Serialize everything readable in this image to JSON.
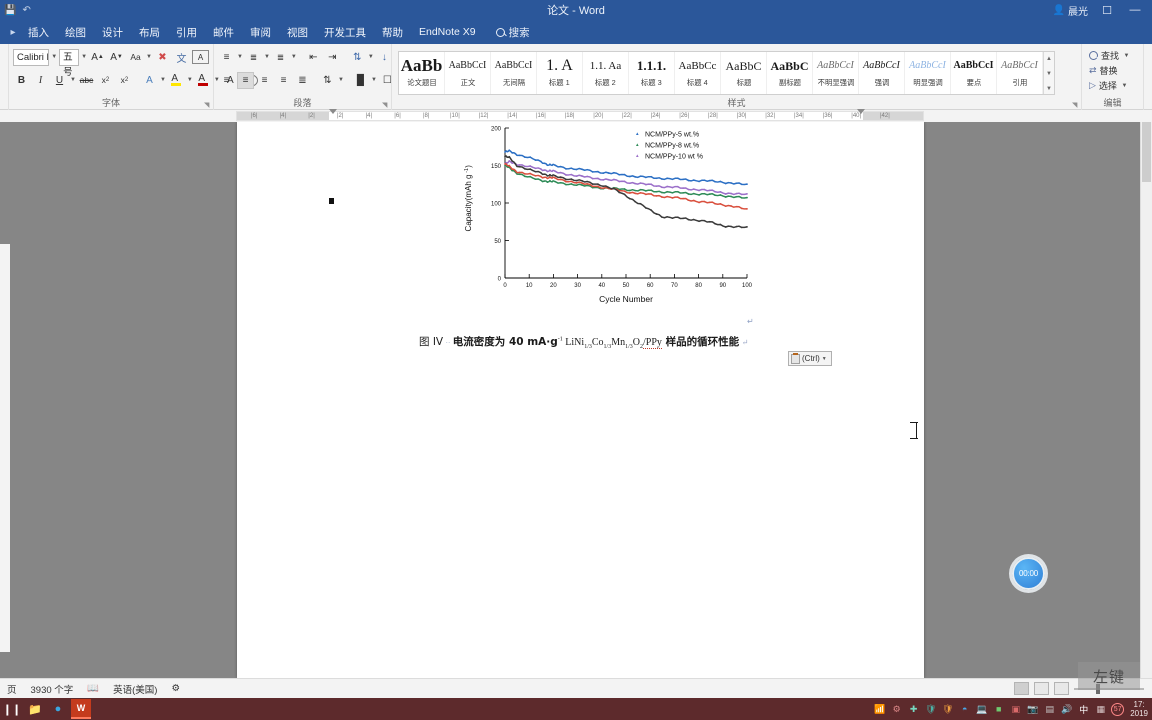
{
  "window": {
    "title": "论文 - Word",
    "user": "晨光",
    "quick_access": [
      "save-icon",
      "undo-icon"
    ],
    "ribbon_display_icon": "ribbon-display-options",
    "minimize": "—"
  },
  "tabs": [
    {
      "label": "插入"
    },
    {
      "label": "绘图"
    },
    {
      "label": "设计"
    },
    {
      "label": "布局"
    },
    {
      "label": "引用"
    },
    {
      "label": "邮件"
    },
    {
      "label": "审阅"
    },
    {
      "label": "视图"
    },
    {
      "label": "开发工具"
    },
    {
      "label": "帮助"
    },
    {
      "label": "EndNote X9"
    }
  ],
  "search": {
    "label": "搜索"
  },
  "font_group": {
    "label": "字体",
    "font_name": "Calibri Light",
    "font_size": "五号",
    "grow": "A",
    "shrink": "A",
    "change_case": "Aa",
    "clear_format": "clear-formatting-icon",
    "phonetic": "phonetic-guide-icon",
    "border": "character-border-icon",
    "bold": "B",
    "italic": "I",
    "underline": "U",
    "strike": "abc",
    "subscript": "x",
    "superscript": "x",
    "text_effects": "A",
    "highlight": "A",
    "font_color": "A",
    "char_shading": "A",
    "enclose": "字"
  },
  "paragraph_group": {
    "label": "段落",
    "buttons": [
      "bullets",
      "numbering",
      "multilevel",
      "decrease-indent",
      "increase-indent",
      "sort",
      "show-marks",
      "align-left",
      "align-center",
      "align-right",
      "justify",
      "distribute",
      "line-spacing",
      "shading",
      "borders"
    ]
  },
  "styles_group": {
    "label": "样式",
    "items": [
      {
        "preview": "AaBb",
        "name": "论文题目"
      },
      {
        "preview": "AaBbCcI",
        "name": "正文"
      },
      {
        "preview": "AaBbCcI",
        "name": "无间隔"
      },
      {
        "preview": "1. A",
        "name": "标题 1"
      },
      {
        "preview": "1.1. Aa",
        "name": "标题 2"
      },
      {
        "preview": "1.1.1.",
        "name": "标题 3"
      },
      {
        "preview": "AaBbCc",
        "name": "标题 4"
      },
      {
        "preview": "AaBbC",
        "name": "标题"
      },
      {
        "preview": "AaBbC",
        "name": "副标题"
      },
      {
        "preview": "AaBbCcI",
        "name": "不明显强调"
      },
      {
        "preview": "AaBbCcI",
        "name": "强调"
      },
      {
        "preview": "AaBbCcI",
        "name": "明显强调"
      },
      {
        "preview": "AaBbCcI",
        "name": "要点"
      },
      {
        "preview": "AaBbCcI",
        "name": "引用"
      }
    ]
  },
  "editing_group": {
    "label": "编辑",
    "find": "查找",
    "replace": "替换",
    "select": "选择"
  },
  "ruler": {
    "ticks": [
      "6",
      "4",
      "2",
      "2",
      "4",
      "6",
      "8",
      "10",
      "12",
      "14",
      "16",
      "18",
      "20",
      "22",
      "24",
      "26",
      "28",
      "30",
      "32",
      "34",
      "36",
      "40",
      "42"
    ]
  },
  "document": {
    "caption_prefix": "图 IV",
    "caption_text": "电流密度为 40 mA·g",
    "caption_sup": "-1",
    "caption_formula_a": " LiNi",
    "caption_formula_sub1": "1/3",
    "caption_formula_b": "Co",
    "caption_formula_sub2": "1/3",
    "caption_formula_c": "Mn",
    "caption_formula_sub3": "1/3",
    "caption_formula_d": "O",
    "caption_formula_sub4": "2",
    "caption_formula_e": "/PPy",
    "caption_suffix": " 样品的循环性能",
    "paste_button": "(Ctrl)",
    "timer": "00:00"
  },
  "chart_data": {
    "type": "line",
    "title": "",
    "xlabel": "Cycle Number",
    "ylabel": "Capacity(mAh g-1)",
    "ylabel_display": "Capacity(mAh g",
    "ylabel_sup": "-1",
    "ylabel_tail": ")",
    "xlim": [
      0,
      100
    ],
    "ylim": [
      0,
      200
    ],
    "xticks": [
      0,
      10,
      20,
      30,
      40,
      50,
      60,
      70,
      80,
      90,
      100
    ],
    "yticks": [
      0,
      50,
      100,
      150,
      200
    ],
    "grid": false,
    "legend_position": "top-right",
    "x": [
      0,
      2,
      5,
      10,
      15,
      18,
      20,
      25,
      30,
      35,
      40,
      45,
      50,
      55,
      60,
      65,
      70,
      75,
      80,
      85,
      90,
      95,
      100
    ],
    "series": [
      {
        "name": "NCM/PPy-5 wt.%",
        "color": "#2b6fc4",
        "marker": "triangle-up",
        "values": [
          168,
          169,
          165,
          160,
          155,
          151,
          150,
          147,
          145,
          143,
          141,
          139,
          137,
          135,
          134,
          133,
          132,
          131,
          130,
          129,
          128,
          126,
          124
        ]
      },
      {
        "name": "NCM/PPy-8 wt.%",
        "color": "#2e8b57",
        "marker": "triangle-down",
        "values": [
          150,
          146,
          140,
          134,
          130,
          129,
          128,
          126,
          124,
          122,
          120,
          119,
          118,
          117,
          116,
          115,
          114,
          113,
          112,
          111,
          110,
          108,
          106
        ]
      },
      {
        "name": "NCM/PPy-10 wt %",
        "color": "#9b6fc9",
        "marker": "circle",
        "values": [
          152,
          155,
          152,
          148,
          145,
          143,
          142,
          139,
          136,
          134,
          132,
          130,
          128,
          126,
          124,
          122,
          121,
          119,
          118,
          116,
          114,
          112,
          111
        ]
      },
      {
        "name": "",
        "color": "#d94f3d",
        "marker": "square",
        "values": [
          152,
          148,
          142,
          138,
          135,
          134,
          133,
          130,
          127,
          124,
          121,
          118,
          115,
          113,
          111,
          109,
          107,
          105,
          102,
          100,
          98,
          95,
          91
        ]
      },
      {
        "name": "",
        "color": "#3a3a3a",
        "marker": "square",
        "values": [
          162,
          160,
          150,
          144,
          140,
          137,
          136,
          133,
          130,
          127,
          124,
          118,
          110,
          100,
          90,
          82,
          80,
          79,
          77,
          74,
          70,
          68,
          67
        ]
      }
    ]
  },
  "status_bar": {
    "page": "页",
    "word_count": "3930 个字",
    "proofing": "proofing-icon",
    "language": "英语(美国)",
    "accessibility": "accessibility-icon",
    "zoom": ""
  },
  "taskbar": {
    "apps": [
      "file-explorer-icon",
      "edge-icon",
      "word-icon"
    ],
    "tray": [
      "wifi-icon",
      "network-icon",
      "sync-icon",
      "shield-icon",
      "flame-icon",
      "bluetooth-icon",
      "monitor-icon",
      "battery-icon",
      "screen-icon",
      "camera-icon",
      "display-icon",
      "volume-icon",
      "ime-icon",
      "calc-icon",
      "badge-57"
    ],
    "clock_time": "17:",
    "clock_date": "2019"
  },
  "overlay": {
    "click_indicator": "左键"
  }
}
